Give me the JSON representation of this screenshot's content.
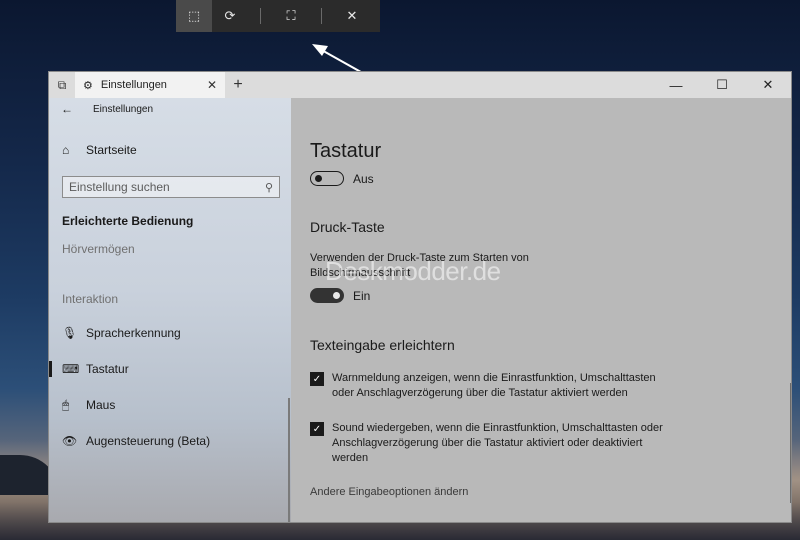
{
  "snip_toolbar": {
    "buttons": [
      {
        "name": "rectangle-snip",
        "icon": "rectangle-snip-icon",
        "glyph": "⬚",
        "active": true
      },
      {
        "name": "freeform-snip",
        "icon": "freeform-snip-icon",
        "glyph": "⟳"
      },
      {
        "name": "fullscreen-snip",
        "icon": "fullscreen-snip-icon",
        "glyph": "⛶"
      },
      {
        "name": "close",
        "icon": "close-icon",
        "glyph": "✕"
      }
    ]
  },
  "window": {
    "tab_title": "Einstellungen",
    "tab_close": "✕",
    "tab_add": "+",
    "tabs_glyph": "⧉",
    "gear_glyph": "⚙",
    "controls": {
      "minimize": "—",
      "maximize": "☐",
      "close": "✕"
    }
  },
  "sidebar": {
    "back_glyph": "←",
    "back_label": "Einstellungen",
    "home": {
      "label": "Startseite",
      "glyph": "⌂"
    },
    "search": {
      "placeholder": "Einstellung suchen",
      "glyph": "⚲"
    },
    "section": "Erleichterte Bedienung",
    "sub_items": [
      "Hörvermögen",
      "Interaktion"
    ],
    "items": [
      {
        "label": "Spracherkennung",
        "glyph": "🎙",
        "icon": "microphone-icon"
      },
      {
        "label": "Tastatur",
        "glyph": "⌨",
        "icon": "keyboard-icon",
        "selected": true
      },
      {
        "label": "Maus",
        "glyph": "🖱",
        "icon": "mouse-icon"
      },
      {
        "label": "Augensteuerung (Beta)",
        "glyph": "👁",
        "icon": "eye-control-icon"
      }
    ]
  },
  "content": {
    "title": "Tastatur",
    "main_toggle": {
      "state": "off",
      "label": "Aus"
    },
    "druck": {
      "heading": "Druck-Taste",
      "description": "Verwenden der Druck-Taste zum Starten von Bildschirmausschnitt",
      "toggle": {
        "state": "on",
        "label": "Ein"
      }
    },
    "watermark": "Deskmodder.de",
    "texteingabe": {
      "heading": "Texteingabe erleichtern",
      "checkboxes": [
        {
          "checked": true,
          "text": "Warnmeldung anzeigen, wenn die Einrastfunktion, Umschalttasten oder Anschlagverzögerung über die Tastatur aktiviert werden"
        },
        {
          "checked": true,
          "text": "Sound wiedergeben, wenn die Einrastfunktion, Umschalttasten oder Anschlagverzögerung über die Tastatur aktiviert oder deaktiviert werden"
        }
      ],
      "check_glyph": "✓"
    },
    "link": "Andere Eingabeoptionen ändern"
  }
}
